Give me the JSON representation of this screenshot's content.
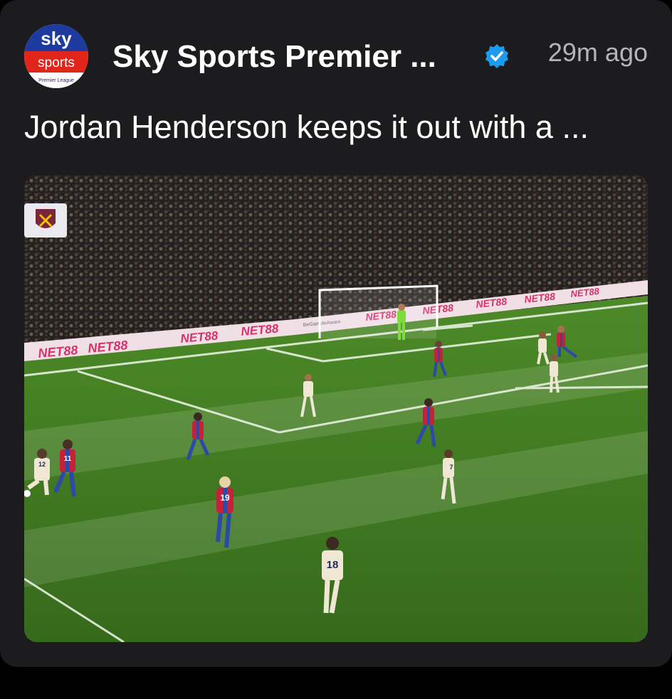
{
  "post": {
    "source": {
      "avatar_text_top": "sky",
      "avatar_text_bottom": "sports",
      "avatar_caption": "Premier League",
      "name": "Sky Sports Premier ...",
      "verified_icon": "verified-badge-icon",
      "timestamp": "29m ago"
    },
    "headline": "Jordan Henderson keeps it out with a ...",
    "media": {
      "ad_board_text": "NET88",
      "ad_board_text_small": "BeGambleAware",
      "club_badge": "west-ham-crest-icon",
      "shirt_numbers": [
        "12",
        "11",
        "19",
        "18",
        "7"
      ]
    }
  },
  "colors": {
    "card_bg": "#1c1c1e",
    "verified": "#1d9bf0",
    "sky_blue": "#0033a0",
    "sky_red": "#e1251b",
    "pitch": "#3a6c1e",
    "palace_blue": "#2c4aa8",
    "palace_red": "#c4213b"
  }
}
